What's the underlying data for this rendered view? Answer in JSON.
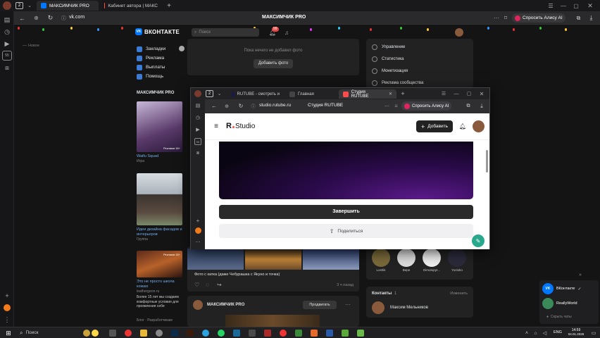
{
  "outer_browser": {
    "tabs": [
      {
        "label": "МАКСИМЧИК PRO"
      },
      {
        "label": "Кабинет автора | МАКС"
      }
    ],
    "address": "vk.com",
    "page_title": "МАКСИМЧИК PRO",
    "alice_label": "Спросить Алису AI"
  },
  "vk": {
    "logo": "ВКОНТАКТЕ",
    "search_placeholder": "Поиск",
    "notif_count": "99",
    "left_header": "Новое",
    "sidebar": [
      {
        "label": "Закладки"
      },
      {
        "label": "Реклама"
      },
      {
        "label": "Выплаты"
      },
      {
        "label": "Помощь"
      }
    ],
    "community": "МАКСИМЧИК PRO",
    "ads": [
      {
        "title": "Waifu Squad",
        "sub": "Игра",
        "img_caption": "Реклама 18+"
      },
      {
        "title": "Идеи дизайна фасадов и интерьеров",
        "sub": "Группа"
      },
      {
        "title": "Это не просто школа кожаю",
        "sub": "leathergeon.ru",
        "desc": "Более 15 лет мы создаем комфортные условия для проявления себя",
        "img_caption": "Реклама 18+"
      }
    ],
    "footer_links": "Блог · Разработчикам",
    "no_photos": "Пока нечего не добавил фото",
    "add_photo": "Добавить фото",
    "right_menu": [
      {
        "label": "Управление"
      },
      {
        "label": "Статистика"
      },
      {
        "label": "Монетизация"
      },
      {
        "label": "Реклама сообщества"
      }
    ],
    "post_caption": "Фото с катка (даже Чебурашка с Якуно и точка)",
    "post_time": "3 ч назад",
    "post_author": "МАКСИМЧИК PRO",
    "promote_label": "Продвигать",
    "members": [
      {
        "name": "Loshik"
      },
      {
        "name": "Bepe"
      },
      {
        "name": "Dimotopyr..."
      },
      {
        "name": "Yuzioko"
      }
    ],
    "contacts_label": "Контакты",
    "contacts_count": "1",
    "contacts_edit": "Изменить",
    "contact_name": "Максим Мельников"
  },
  "inner_browser": {
    "tabs": [
      {
        "label": "RUTUBE - смотреть и"
      },
      {
        "label": "Главная"
      },
      {
        "label": "Студия RUTUBE"
      }
    ],
    "address": "studio.rutube.ru",
    "page_title": "Студия RUTUBE",
    "alice_label": "Спросить Алису AI",
    "studio": {
      "logo_r": "R",
      "logo_text": "Studio",
      "add_label": "Добавить",
      "finish_label": "Завершить",
      "share_label": "Поделиться"
    }
  },
  "messenger": {
    "items": [
      {
        "label": "ВКонтакте"
      },
      {
        "label": "ReallyWorld"
      }
    ],
    "hide_chats": "Скрыть чаты"
  },
  "taskbar": {
    "search_label": "Поиск",
    "lang": "ENG",
    "time": "14:59",
    "date": "04.01.2026"
  },
  "colors": {
    "vk_blue": "#0077ff",
    "rutube_red": "#ff4b4b",
    "alice_pink": "#e0245e"
  }
}
